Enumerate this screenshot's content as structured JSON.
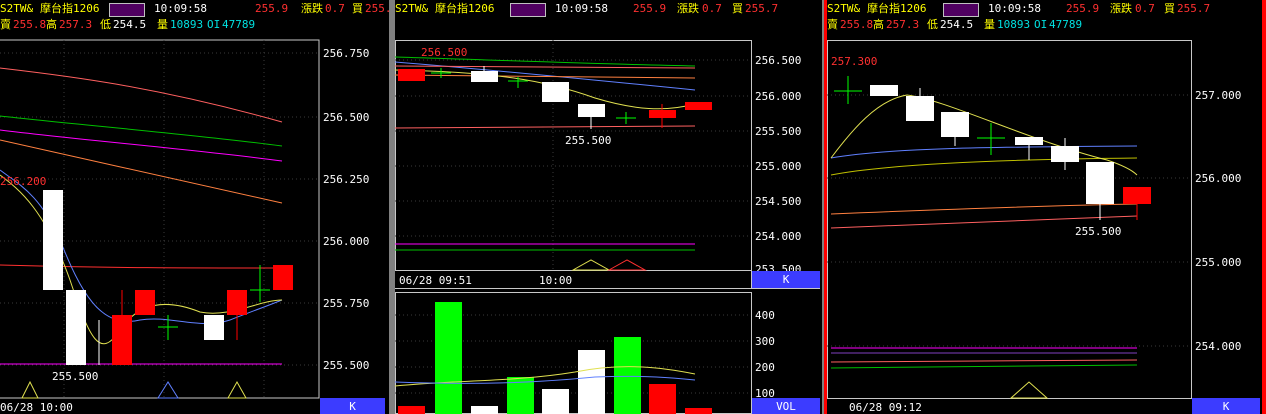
{
  "header": {
    "symbol": "S2TW&",
    "name": "摩台指1206",
    "time": "10:09:58",
    "price": "255.9",
    "change_label": "漲跌",
    "change": "0.7",
    "buy_label": "買",
    "buy": "255.7",
    "sell_label": "賣",
    "sell": "255.8",
    "high_label": "高",
    "high": "257.3",
    "low_label": "低",
    "low": "254.5",
    "vol_label": "量",
    "volume": "10893",
    "oi_label": "OI",
    "oi": "47789"
  },
  "panels": {
    "left": {
      "high_marker": "256.200",
      "low_marker": "255.500",
      "date_label": "06/28 10:00",
      "button": "K",
      "y_ticks": [
        "256.750",
        "256.500",
        "256.250",
        "256.000",
        "255.750",
        "255.500"
      ]
    },
    "middle": {
      "high_marker": "256.500",
      "low_marker": "255.500",
      "date_label": "06/28 09:51",
      "time_tick": "10:00",
      "button": "K",
      "y_ticks": [
        "256.500",
        "256.000",
        "255.500",
        "255.000",
        "254.500",
        "254.000",
        "253.500"
      ],
      "vol_button": "VOL",
      "vol_ticks": [
        "400",
        "300",
        "200",
        "100"
      ]
    },
    "right": {
      "high_marker": "257.300",
      "low_marker": "255.500",
      "date_label": "06/28 09:12",
      "button": "K",
      "y_ticks": [
        "257.000",
        "256.000",
        "255.000",
        "254.000"
      ]
    }
  },
  "colors": {
    "up": "#ff0000",
    "down": "#ffffff",
    "flat": "#00ff00",
    "vol_up": "#00ff00",
    "axis_button": "#3c3cff",
    "panel_divider": "#c0c0c0",
    "active_border": "#ff0000"
  },
  "chart_data": [
    {
      "type": "candlestick",
      "title": "",
      "y_axis_ticks": [
        256.75,
        256.5,
        256.25,
        256.0,
        255.75,
        255.5
      ],
      "candles": [
        {
          "o": 256.2,
          "h": 256.2,
          "l": 255.8,
          "c": 255.8
        },
        {
          "o": 255.8,
          "h": 255.8,
          "l": 255.5,
          "c": 255.5
        },
        {
          "o": 255.5,
          "h": 255.7,
          "l": 255.5,
          "c": 255.7
        },
        {
          "o": 255.7,
          "h": 255.8,
          "l": 255.7,
          "c": 255.8
        },
        {
          "o": 255.7,
          "h": 255.7,
          "l": 255.6,
          "c": 255.7
        },
        {
          "o": 255.7,
          "h": 255.7,
          "l": 255.5,
          "c": 255.6
        },
        {
          "o": 255.7,
          "h": 255.8,
          "l": 255.6,
          "c": 255.8
        },
        {
          "o": 255.8,
          "h": 255.9,
          "l": 255.8,
          "c": 255.8
        },
        {
          "o": 255.8,
          "h": 255.9,
          "l": 255.8,
          "c": 255.9
        }
      ]
    },
    {
      "type": "candlestick",
      "title": "",
      "y_axis_ticks": [
        256.5,
        256.0,
        255.5,
        255.0,
        254.5,
        254.0,
        253.5
      ],
      "candles": [
        {
          "o": 256.2,
          "h": 256.5,
          "l": 256.2,
          "c": 256.4
        },
        {
          "o": 256.3,
          "h": 256.4,
          "l": 256.2,
          "c": 256.2
        },
        {
          "o": 256.2,
          "h": 256.3,
          "l": 256.1,
          "c": 256.2
        },
        {
          "o": 256.2,
          "h": 256.2,
          "l": 255.9,
          "c": 255.9
        },
        {
          "o": 255.9,
          "h": 255.9,
          "l": 255.5,
          "c": 255.7
        },
        {
          "o": 255.7,
          "h": 255.8,
          "l": 255.6,
          "c": 255.7
        },
        {
          "o": 255.7,
          "h": 255.8,
          "l": 255.6,
          "c": 255.8
        },
        {
          "o": 255.8,
          "h": 255.9,
          "l": 255.8,
          "c": 255.9
        }
      ],
      "volume": [
        50,
        470,
        40,
        160,
        120,
        265,
        320,
        135,
        45
      ]
    },
    {
      "type": "candlestick",
      "title": "",
      "y_axis_ticks": [
        257.0,
        256.0,
        255.0,
        254.0
      ],
      "candles": [
        {
          "o": 257.1,
          "h": 257.3,
          "l": 257.0,
          "c": 257.1
        },
        {
          "o": 257.1,
          "h": 257.1,
          "l": 257.0,
          "c": 257.0
        },
        {
          "o": 257.0,
          "h": 257.0,
          "l": 256.7,
          "c": 256.7
        },
        {
          "o": 256.8,
          "h": 256.8,
          "l": 256.5,
          "c": 256.5
        },
        {
          "o": 256.4,
          "h": 256.6,
          "l": 256.3,
          "c": 256.4
        },
        {
          "o": 256.4,
          "h": 256.4,
          "l": 256.2,
          "c": 256.4
        },
        {
          "o": 256.3,
          "h": 256.3,
          "l": 256.1,
          "c": 256.1
        },
        {
          "o": 256.1,
          "h": 256.1,
          "l": 255.5,
          "c": 255.6
        },
        {
          "o": 255.6,
          "h": 255.8,
          "l": 255.5,
          "c": 255.8
        }
      ]
    }
  ]
}
